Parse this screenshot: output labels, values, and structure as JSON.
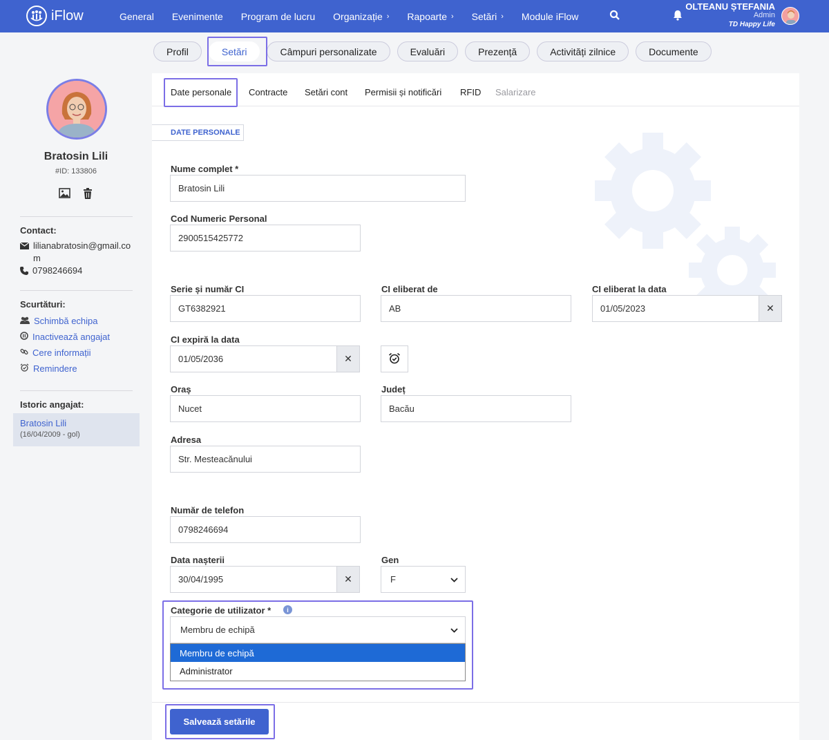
{
  "app": {
    "logo_text": "iFlow"
  },
  "nav": {
    "items": [
      {
        "label": "General"
      },
      {
        "label": "Evenimente"
      },
      {
        "label": "Program de lucru"
      },
      {
        "label": "Organizație"
      },
      {
        "label": "Rapoarte"
      },
      {
        "label": "Setări"
      },
      {
        "label": "Module iFlow"
      }
    ]
  },
  "user": {
    "name": "OLTEANU ȘTEFANIA",
    "role": "Admin",
    "team": "TD Happy Life"
  },
  "main_tabs": [
    "Profil",
    "Setări",
    "Câmpuri personalizate",
    "Evaluări",
    "Prezență",
    "Activități zilnice",
    "Documente"
  ],
  "employee": {
    "name": "Bratosin Lili",
    "id": "#ID: 133806",
    "contact_title": "Contact:",
    "email": "lilianabratosin@gmail.com",
    "phone": "0798246694",
    "shortcuts_title": "Scurtături:",
    "shortcuts": [
      "Schimbă echipa",
      "Inactivează angajat",
      "Cere informații",
      "Remindere"
    ],
    "history_title": "Istoric angajat:",
    "history_name": "Bratosin Lili",
    "history_dates": "(16/04/2009 - gol)"
  },
  "sub_tabs": [
    "Date personale",
    "Contracte",
    "Setări cont",
    "Permisii și notificări",
    "RFID",
    "Salarizare"
  ],
  "section_tag": "DATE PERSONALE",
  "form": {
    "full_name": {
      "label": "Nume complet *",
      "value": "Bratosin Lili"
    },
    "cnp": {
      "label": "Cod Numeric Personal",
      "value": "2900515425772"
    },
    "ci_series": {
      "label": "Serie și număr CI",
      "value": "GT6382921"
    },
    "ci_issuer": {
      "label": "CI eliberat de",
      "value": "AB"
    },
    "ci_issue_date": {
      "label": "CI eliberat la data",
      "value": "01/05/2023"
    },
    "ci_expiry": {
      "label": "CI expiră la data",
      "value": "01/05/2036"
    },
    "city": {
      "label": "Oraș",
      "value": "Nucet"
    },
    "county": {
      "label": "Județ",
      "value": "Bacău"
    },
    "address": {
      "label": "Adresa",
      "value": "Str. Mesteacănului"
    },
    "phone": {
      "label": "Număr de telefon",
      "value": "0798246694"
    },
    "birth_date": {
      "label": "Data nașterii",
      "value": "30/04/1995"
    },
    "gender": {
      "label": "Gen",
      "value": "F"
    },
    "user_category": {
      "label": "Categorie de utilizator *",
      "value": "Membru de echipă",
      "options": [
        "Membru de echipă",
        "Administrator"
      ]
    },
    "clear_symbol": "✕"
  },
  "save_button": "Salvează setările",
  "colors": {
    "primary": "#3f63cf",
    "highlight": "#7b6ee6",
    "selected_option": "#1e6ad6"
  }
}
